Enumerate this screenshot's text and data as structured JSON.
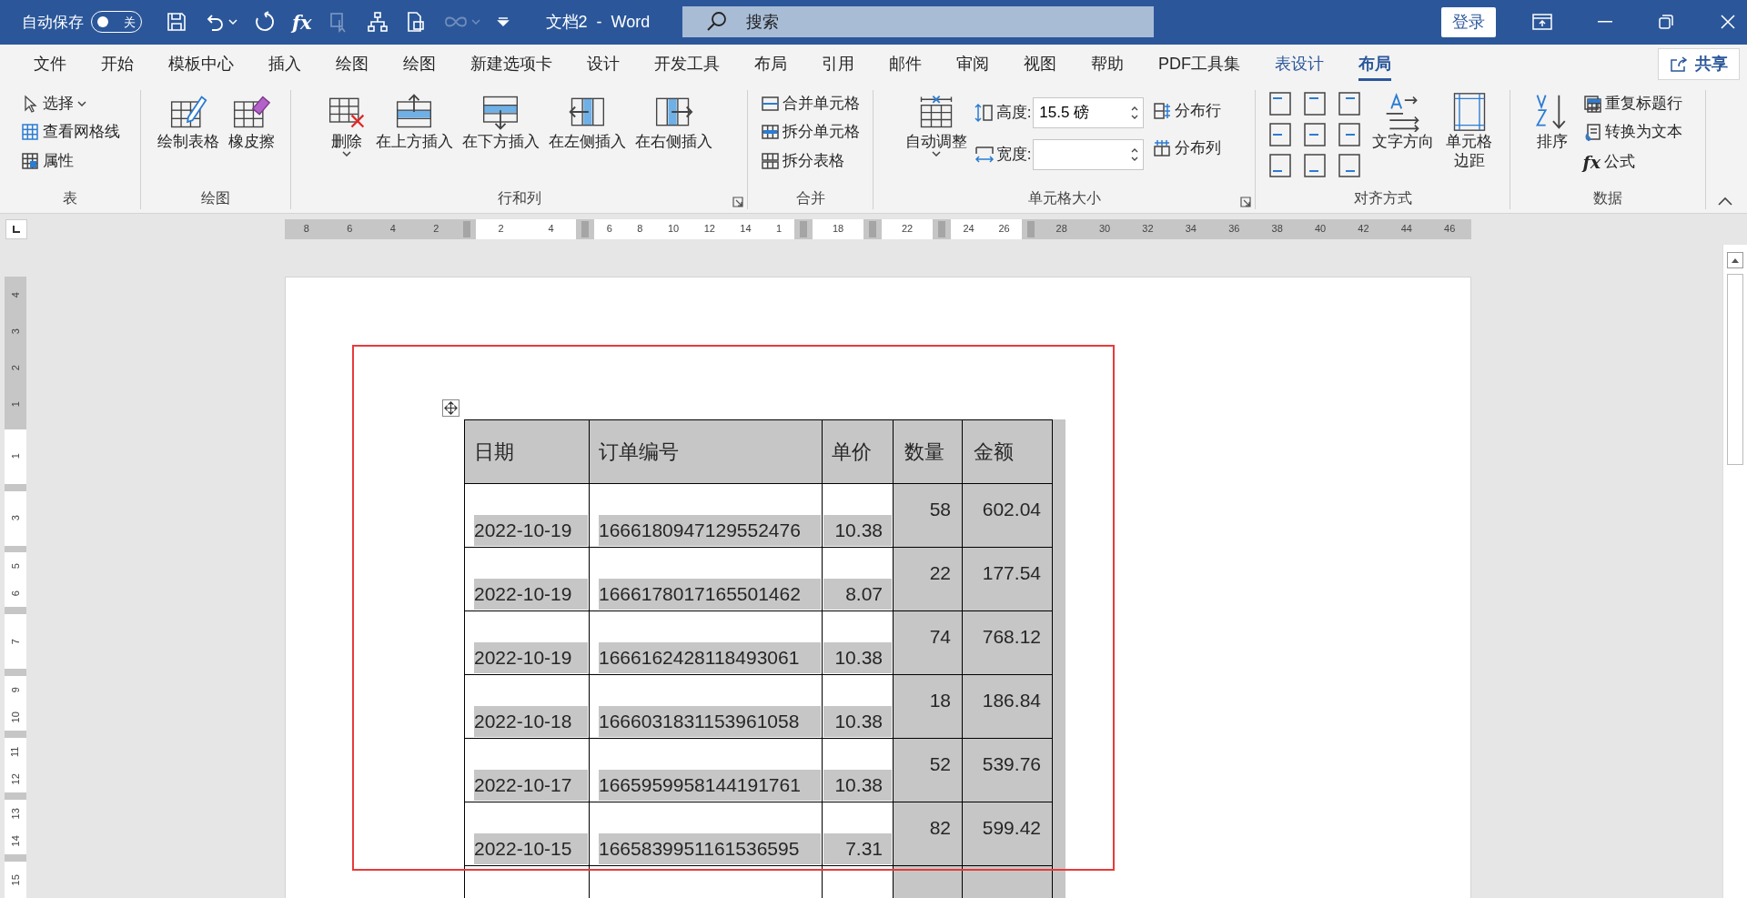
{
  "title_bar": {
    "autosave_label": "自动保存",
    "autosave": {
      "label": "关",
      "on": false
    },
    "formula_icon": "fx",
    "doc_title": "文档2  -  Word",
    "search": {
      "placeholder": "搜索"
    },
    "login": "登录"
  },
  "tabs": [
    {
      "label": "文件",
      "selected": false,
      "kind": "normal"
    },
    {
      "label": "开始",
      "selected": false,
      "kind": "normal"
    },
    {
      "label": "模板中心",
      "selected": false,
      "kind": "normal"
    },
    {
      "label": "插入",
      "selected": false,
      "kind": "normal"
    },
    {
      "label": "绘图",
      "selected": false,
      "kind": "normal"
    },
    {
      "label": "绘图",
      "selected": false,
      "kind": "normal"
    },
    {
      "label": "新建选项卡",
      "selected": false,
      "kind": "normal"
    },
    {
      "label": "设计",
      "selected": false,
      "kind": "normal"
    },
    {
      "label": "开发工具",
      "selected": false,
      "kind": "normal"
    },
    {
      "label": "布局",
      "selected": false,
      "kind": "normal"
    },
    {
      "label": "引用",
      "selected": false,
      "kind": "normal"
    },
    {
      "label": "邮件",
      "selected": false,
      "kind": "normal"
    },
    {
      "label": "审阅",
      "selected": false,
      "kind": "normal"
    },
    {
      "label": "视图",
      "selected": false,
      "kind": "normal"
    },
    {
      "label": "帮助",
      "selected": false,
      "kind": "normal"
    },
    {
      "label": "PDF工具集",
      "selected": false,
      "kind": "normal"
    },
    {
      "label": "表设计",
      "selected": false,
      "kind": "context"
    },
    {
      "label": "布局",
      "selected": true,
      "kind": "context"
    }
  ],
  "share": "共享",
  "ribbon_groups": [
    {
      "label": "表",
      "columns": [
        [
          {
            "kind": "small",
            "label": "选择",
            "dropdown": true
          },
          {
            "kind": "small",
            "label": "查看网格线"
          },
          {
            "kind": "small",
            "label": "属性"
          }
        ]
      ]
    },
    {
      "label": "绘图",
      "columns": [
        [
          {
            "kind": "large",
            "label": "绘制表格"
          }
        ],
        [
          {
            "kind": "large",
            "label": "橡皮擦"
          }
        ]
      ]
    },
    {
      "label": "行和列",
      "launcher": true,
      "columns": [
        [
          {
            "kind": "large",
            "label": "删除",
            "dropdown": true
          }
        ],
        [
          {
            "kind": "large",
            "label": "在上方插入"
          }
        ],
        [
          {
            "kind": "large",
            "label": "在下方插入"
          }
        ],
        [
          {
            "kind": "large",
            "label": "在左侧插入"
          }
        ],
        [
          {
            "kind": "large",
            "label": "在右侧插入"
          }
        ]
      ]
    },
    {
      "label": "合并",
      "columns": [
        [
          {
            "kind": "small",
            "label": "合并单元格"
          },
          {
            "kind": "small",
            "label": "拆分单元格"
          },
          {
            "kind": "small",
            "label": "拆分表格"
          }
        ]
      ]
    },
    {
      "label": "单元格大小",
      "launcher": true,
      "columns": [
        [
          {
            "kind": "large",
            "label": "自动调整",
            "dropdown": true
          }
        ],
        [
          {
            "kind": "spin",
            "label": "高度:",
            "value": "15.5 磅"
          },
          {
            "kind": "spin",
            "label": "宽度:"
          }
        ],
        [
          {
            "kind": "small",
            "label": "分布行"
          },
          {
            "kind": "small",
            "label": "分布列"
          }
        ]
      ]
    },
    {
      "label": "对齐方式",
      "columns": [
        [
          {
            "kind": "align-grid"
          }
        ],
        [
          {
            "kind": "large",
            "label": "文字方向"
          }
        ],
        [
          {
            "kind": "large",
            "label": "单元格边距"
          }
        ]
      ]
    },
    {
      "label": "数据",
      "columns": [
        [
          {
            "kind": "large",
            "label": "排序"
          }
        ],
        [
          {
            "kind": "small",
            "label": "重复标题行"
          },
          {
            "kind": "small",
            "label": "转换为文本"
          },
          {
            "kind": "small",
            "label": "公式",
            "icon_text": "fx"
          }
        ]
      ]
    }
  ],
  "ruler": {
    "horizontal": [
      {
        "kind": "margin",
        "labels": [
          "8",
          "6",
          "4",
          "2"
        ]
      },
      {
        "kind": "cell",
        "labels": [
          "2",
          "4"
        ]
      },
      {
        "kind": "cell",
        "labels": [
          "6",
          "8",
          "10",
          "12",
          "14",
          "1"
        ]
      },
      {
        "kind": "cell",
        "labels": [
          "18"
        ]
      },
      {
        "kind": "cell",
        "labels": [
          "22"
        ]
      },
      {
        "kind": "cell",
        "labels": [
          "24",
          "26"
        ]
      },
      {
        "kind": "margin",
        "labels": [
          "28",
          "30",
          "32",
          "34",
          "36",
          "38",
          "40",
          "42",
          "44",
          "46"
        ]
      }
    ],
    "vertical": [
      {
        "kind": "margin",
        "labels": [
          "4",
          "3",
          "2",
          "1"
        ]
      },
      {
        "kind": "cell",
        "labels": [
          "1"
        ]
      },
      {
        "kind": "cell",
        "labels": [
          "3"
        ]
      },
      {
        "kind": "cell",
        "labels": [
          "5",
          "6"
        ]
      },
      {
        "kind": "cell",
        "labels": [
          "7"
        ]
      },
      {
        "kind": "cell",
        "labels": [
          "9",
          "10"
        ]
      },
      {
        "kind": "cell",
        "labels": [
          "11",
          "12"
        ]
      },
      {
        "kind": "cell",
        "labels": [
          "13",
          "14"
        ]
      },
      {
        "kind": "cell",
        "labels": [
          "15"
        ]
      }
    ]
  },
  "table": {
    "columns": [
      "日期",
      "订单编号",
      "单价",
      "数量",
      "金额"
    ],
    "rows": [
      [
        "2022-10-19",
        "1666180947129552476",
        "10.38",
        "58",
        "602.04"
      ],
      [
        "2022-10-19",
        "1666178017165501462",
        "8.07",
        "22",
        "177.54"
      ],
      [
        "2022-10-19",
        "1666162428118493061",
        "10.38",
        "74",
        "768.12"
      ],
      [
        "2022-10-18",
        "1666031831153961058",
        "10.38",
        "18",
        "186.84"
      ],
      [
        "2022-10-17",
        "1665959958144191761",
        "10.38",
        "52",
        "539.76"
      ],
      [
        "2022-10-15",
        "1665839951161536595",
        "7.31",
        "82",
        "599.42"
      ]
    ]
  }
}
